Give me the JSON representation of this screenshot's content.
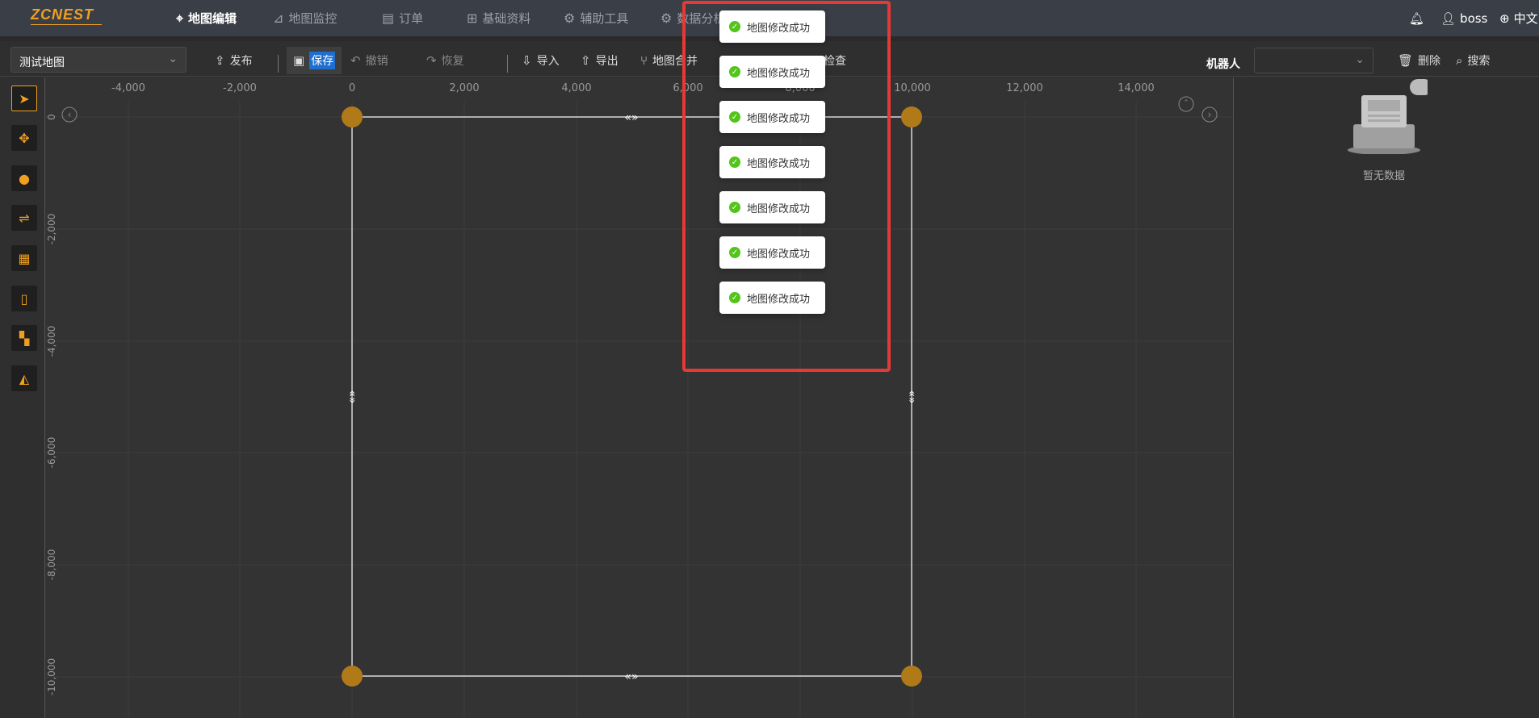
{
  "app": {
    "logo": "ZCNEST"
  },
  "nav": [
    {
      "label": "地图编辑",
      "icon": "map-pin-icon"
    },
    {
      "label": "地图监控",
      "icon": "chart-line-icon"
    },
    {
      "label": "订单",
      "icon": "document-icon"
    },
    {
      "label": "基础资料",
      "icon": "sliders-icon"
    },
    {
      "label": "辅助工具",
      "icon": "gear-icon"
    },
    {
      "label": "数据分析",
      "icon": "gear-icon"
    }
  ],
  "user": {
    "name": "boss",
    "language": "中文"
  },
  "toolbar": {
    "map_selected": "测试地图",
    "publish": "发布",
    "save": "保存",
    "undo": "撤销",
    "redo": "恢复",
    "import": "导入",
    "export": "导出",
    "merge": "地图合并",
    "check": "检查",
    "robot_label": "机器人",
    "robot_value": "",
    "delete": "删除",
    "search": "搜索"
  },
  "canvas": {
    "x_ticks": [
      "-4,000",
      "-2,000",
      "0",
      "2,000",
      "4,000",
      "6,000",
      "8,000",
      "10,000",
      "12,000",
      "14,000"
    ],
    "y_ticks": [
      "0",
      "-2,000",
      "-4,000",
      "-6,000",
      "-8,000",
      "-10,000"
    ]
  },
  "right_panel": {
    "empty_text": "暂无数据"
  },
  "toasts": [
    "地图修改成功",
    "地图修改成功",
    "地图修改成功",
    "地图修改成功",
    "地图修改成功",
    "地图修改成功",
    "地图修改成功"
  ],
  "colors": {
    "accent": "#f0a020",
    "highlight": "#e53935",
    "success": "#52c41a"
  }
}
